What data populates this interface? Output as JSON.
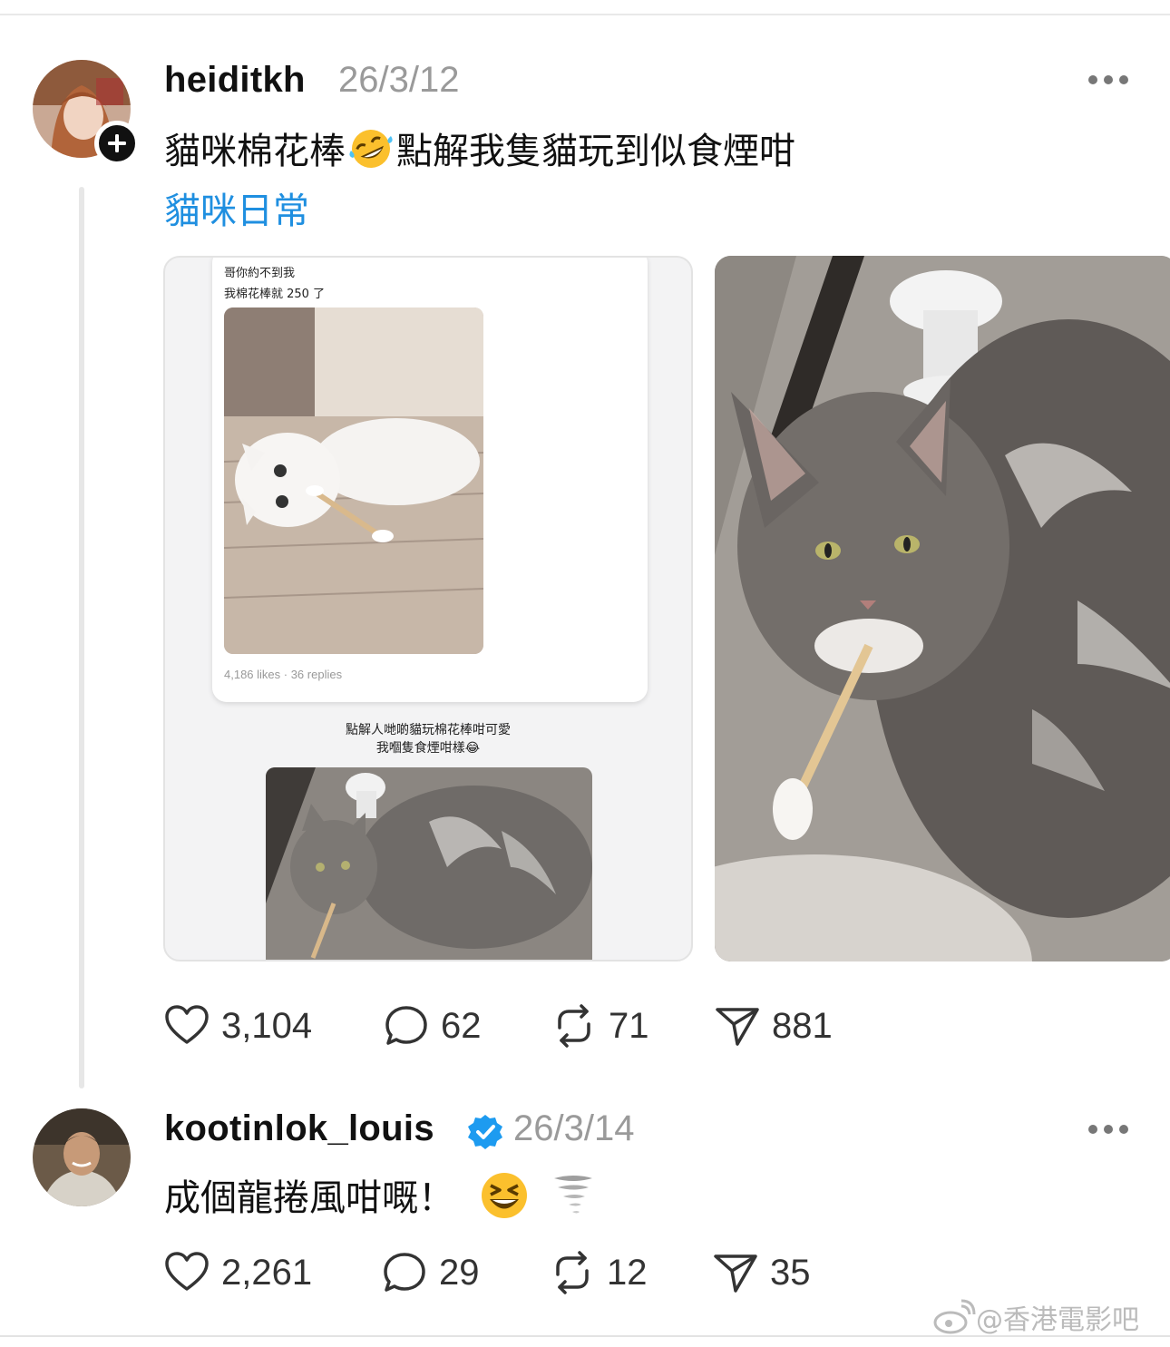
{
  "post1": {
    "username": "heiditkh",
    "time": "26/3/12",
    "text": "貓咪棉花棒",
    "text_after_emoji": "點解我隻貓玩到似食煙咁",
    "emoji": "rolling-on-floor-laughing",
    "topic": "貓咪日常",
    "media1": {
      "line1": "哥你約不到我",
      "line2": "我棉花棒就 250 了",
      "stats": "4,186 likes · 36 replies",
      "caption1": "點解人哋啲貓玩棉花棒咁可愛",
      "caption2": "我嗰隻食煙咁樣😂"
    },
    "likes": "3,104",
    "replies": "62",
    "reposts": "71",
    "shares": "881"
  },
  "post2": {
    "username": "kootinlok_louis",
    "verified": true,
    "time": "26/3/14",
    "text": "成個龍捲風咁嘅！",
    "emojis": [
      "grinning-squinting-face",
      "tornado"
    ],
    "likes": "2,261",
    "replies": "29",
    "reposts": "12",
    "shares": "35"
  },
  "watermark": "@香港電影吧",
  "colors": {
    "topic": "#1f8fe0",
    "verified": "#1d9bf0"
  }
}
